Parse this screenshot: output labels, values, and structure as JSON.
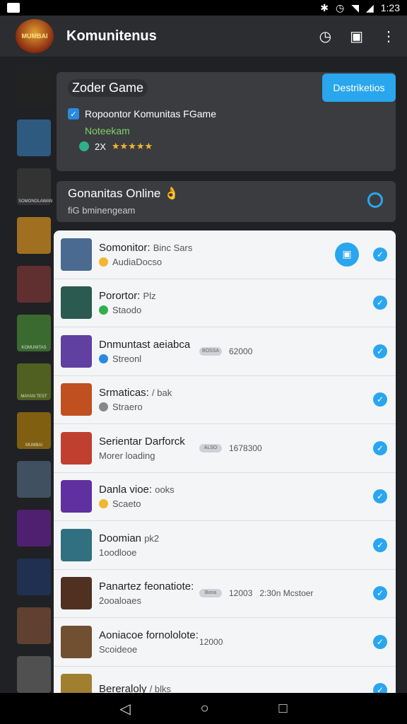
{
  "status": {
    "time": "1:23"
  },
  "app": {
    "title": "Komunitenus",
    "logo_text": "MUMBAI"
  },
  "card1": {
    "title": "Zoder Game",
    "button": "Destriketios",
    "line1": "Ropoontor Komunitas FGame",
    "line2": "Noteekam",
    "rating_prefix": "2X",
    "stars": "★★★★★"
  },
  "card2": {
    "title": "Gonanitas Online 👌",
    "subtitle": "fiG bminengeam"
  },
  "sidebar": [
    {
      "label": "",
      "color": "#222"
    },
    {
      "label": "",
      "color": "#2e5a80"
    },
    {
      "label": "SOMONOLAWAN",
      "color": "#333"
    },
    {
      "label": "",
      "color": "#a07020"
    },
    {
      "label": "",
      "color": "#603030"
    },
    {
      "label": "KOMUNITAS",
      "color": "#3a6a30"
    },
    {
      "label": "MAYAN TEST",
      "color": "#506020"
    },
    {
      "label": "MUMBAI",
      "color": "#806010"
    },
    {
      "label": "",
      "color": "#405060"
    },
    {
      "label": "",
      "color": "#502070"
    },
    {
      "label": "",
      "color": "#203050"
    },
    {
      "label": "",
      "color": "#604030"
    },
    {
      "label": "",
      "color": "#505050"
    }
  ],
  "items": [
    {
      "name": "Somonitor:",
      "extra": "Binc Sars",
      "desc": "AudiaDocso",
      "dot": "#f2b630",
      "mid_pill": "",
      "mid_val": "",
      "mid_val2": "",
      "color": "#4a6a90",
      "round": true
    },
    {
      "name": "Porortor:",
      "extra": "Plz",
      "desc": "Staodo",
      "dot": "#2fb04a",
      "mid_pill": "",
      "mid_val": "",
      "mid_val2": "",
      "color": "#2a5a50",
      "round": false
    },
    {
      "name": "Dnmuntast aeiabca",
      "extra": "",
      "desc": "Streonl",
      "dot": "#2a8ae0",
      "mid_pill": "BOSSA",
      "mid_val": "62000",
      "mid_val2": "",
      "color": "#6040a0",
      "round": false
    },
    {
      "name": "Srmaticas:",
      "extra": "/ bak",
      "desc": "Straero",
      "dot": "#888",
      "mid_pill": "",
      "mid_val": "",
      "mid_val2": "",
      "color": "#c05020",
      "round": false
    },
    {
      "name": "Serientar Darforck",
      "extra": "",
      "desc": "Morer loading",
      "dot": "",
      "mid_pill": "ALSO",
      "mid_val": "1678300",
      "mid_val2": "",
      "color": "#c04030",
      "round": false
    },
    {
      "name": "Danla vioe:",
      "extra": "ooks",
      "desc": "Scaeto",
      "dot": "#f2b630",
      "mid_pill": "",
      "mid_val": "",
      "mid_val2": "",
      "color": "#6030a0",
      "round": false
    },
    {
      "name": "Doomian",
      "extra": "pk2",
      "desc": "1oodlooe",
      "dot": "",
      "mid_pill": "",
      "mid_val": "",
      "mid_val2": "",
      "color": "#307080",
      "round": false
    },
    {
      "name": "Panartez feonatiote:",
      "extra": "",
      "desc": "2ooaloaes",
      "dot": "",
      "mid_pill": "Bona",
      "mid_val": "12003",
      "mid_val2": "2:30n  Mcstoer",
      "color": "#503020",
      "round": false
    },
    {
      "name": "Aoniacoe fornololote:",
      "extra": "",
      "desc": "Scoideoe",
      "dot": "",
      "mid_pill": "",
      "mid_val": "12000",
      "mid_val2": "",
      "color": "#705030",
      "round": false
    },
    {
      "name": "Bereraloly",
      "extra": "/ blks",
      "desc": "",
      "dot": "",
      "mid_pill": "",
      "mid_val": "",
      "mid_val2": "",
      "color": "#a08030",
      "round": false
    }
  ]
}
